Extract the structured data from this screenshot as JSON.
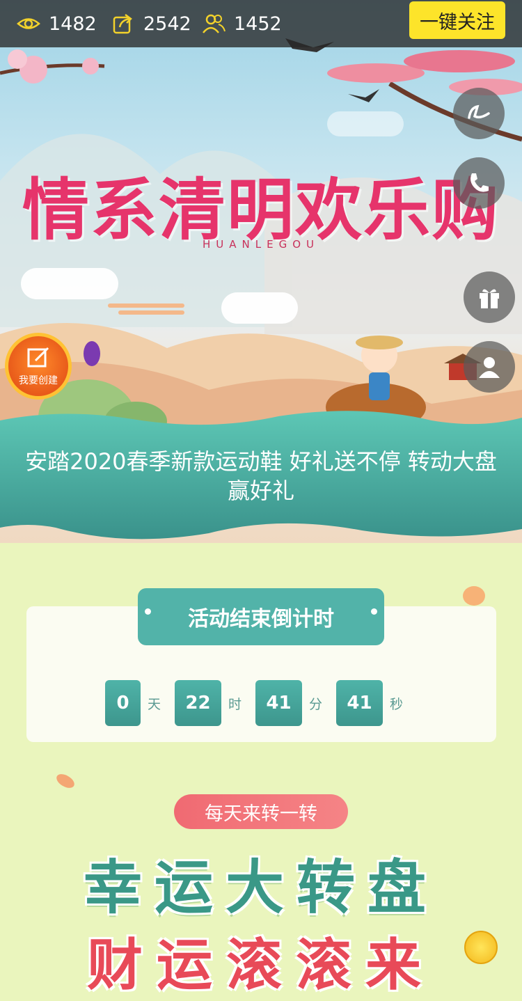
{
  "stats": {
    "views": "1482",
    "shares": "2542",
    "participants": "1452"
  },
  "follow_label": "一键关注",
  "create_label": "我要创建",
  "banner": {
    "title_cn": "情系清明欢乐购",
    "title_en": "HUANLEGOU"
  },
  "headline": "安踏2020春季新款运动鞋 好礼送不停 转动大盘赢好礼",
  "countdown": {
    "title": "活动结束倒计时",
    "days": "0",
    "day_unit": "天",
    "hours": "22",
    "hour_unit": "时",
    "minutes": "41",
    "minute_unit": "分",
    "seconds": "41",
    "second_unit": "秒"
  },
  "daily_label": "每天来转一转",
  "wheel": {
    "title": "幸运大转盘",
    "subtitle": "财运滚滚来"
  },
  "icons": [
    "eye-icon",
    "share-icon",
    "users-icon",
    "voice-icon",
    "phone-icon",
    "gift-icon",
    "user-icon",
    "edit-icon"
  ],
  "colors": {
    "accent_yellow": "#fde42a",
    "teal": "#52b3a9",
    "pink": "#f06a72",
    "bg": "#eaf5bd"
  }
}
